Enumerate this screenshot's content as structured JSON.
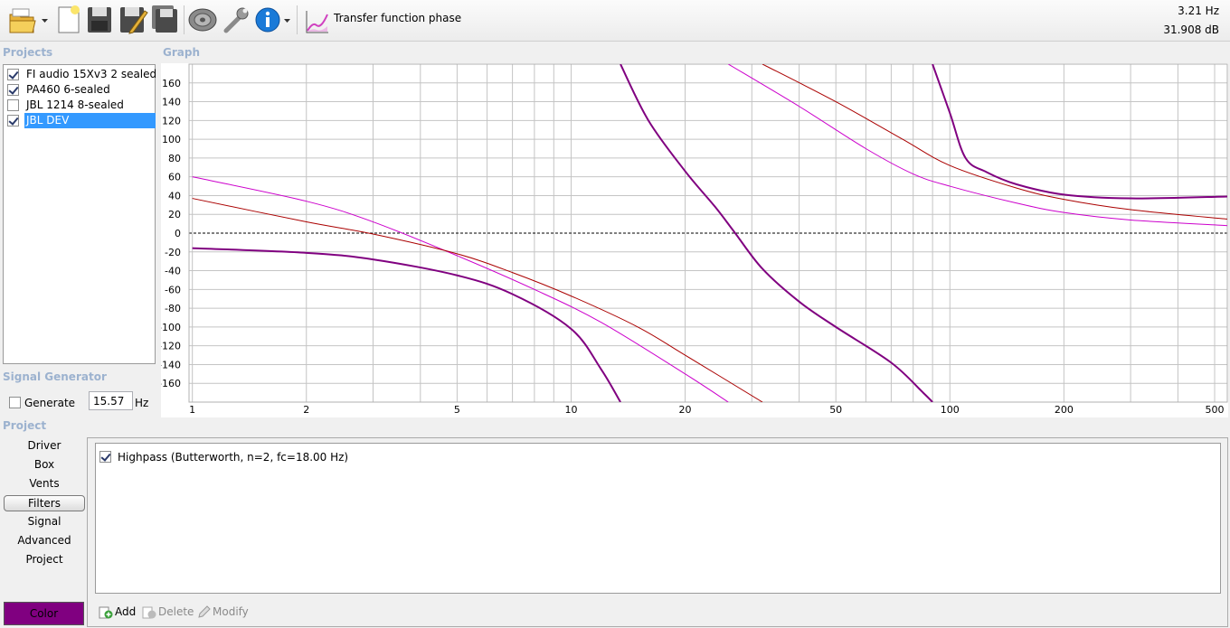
{
  "toolbar": {
    "function_label": "Transfer function phase",
    "readout_freq": "3.21 Hz",
    "readout_level": "31.908 dB"
  },
  "projects": {
    "header": "Projects",
    "items": [
      {
        "name": "FI audio 15Xv3 2 sealed",
        "checked": true,
        "selected": false
      },
      {
        "name": "PA460 6-sealed",
        "checked": true,
        "selected": false
      },
      {
        "name": "JBL 1214 8-sealed",
        "checked": false,
        "selected": false
      },
      {
        "name": "JBL DEV",
        "checked": true,
        "selected": true
      }
    ]
  },
  "graph": {
    "header": "Graph"
  },
  "signal_generator": {
    "header": "Signal Generator",
    "generate_label": "Generate",
    "generate_checked": false,
    "frequency_value": "15.57",
    "unit": "Hz"
  },
  "project": {
    "header": "Project",
    "nav": [
      "Driver",
      "Box",
      "Vents",
      "Filters",
      "Signal",
      "Advanced",
      "Project"
    ],
    "active_nav": "Filters",
    "color_label": "Color",
    "color_value": "#800080"
  },
  "filters": {
    "items": [
      {
        "label": "Highpass (Butterworth, n=2, fc=18.00 Hz)",
        "checked": true
      }
    ],
    "add_label": "Add",
    "delete_label": "Delete",
    "modify_label": "Modify"
  },
  "chart_data": {
    "type": "line",
    "xscale": "log",
    "xlim": [
      0.98,
      540
    ],
    "ylim": [
      -180,
      180
    ],
    "x_ticks": [
      1,
      2,
      5,
      10,
      20,
      50,
      100,
      200,
      500
    ],
    "y_ticks": [
      160,
      140,
      120,
      100,
      80,
      60,
      40,
      20,
      0,
      -20,
      -40,
      -60,
      -80,
      -100,
      -120,
      -140,
      -160
    ],
    "zero_line": "dashed",
    "grid": true,
    "series": [
      {
        "color": "#800080",
        "width": 2,
        "points": [
          [
            1,
            -16
          ],
          [
            2,
            -21
          ],
          [
            3,
            -28
          ],
          [
            5,
            -45
          ],
          [
            7,
            -65
          ],
          [
            10,
            -102
          ],
          [
            12,
            -145
          ],
          [
            13.5,
            -180
          ]
        ]
      },
      {
        "color": "#800080",
        "width": 2,
        "points": [
          [
            13.5,
            180
          ],
          [
            16,
            120
          ],
          [
            20,
            66
          ],
          [
            24,
            28
          ],
          [
            27,
            1
          ],
          [
            32,
            -38
          ],
          [
            40,
            -73
          ],
          [
            50,
            -100
          ],
          [
            70,
            -138
          ],
          [
            85,
            -170
          ],
          [
            90,
            -180
          ]
        ]
      },
      {
        "color": "#800080",
        "width": 2,
        "points": [
          [
            90,
            180
          ],
          [
            100,
            128
          ],
          [
            110,
            80
          ],
          [
            125,
            65
          ],
          [
            150,
            52
          ],
          [
            200,
            41
          ],
          [
            300,
            37
          ],
          [
            540,
            39
          ]
        ]
      },
      {
        "color": "#cc00cc",
        "width": 1,
        "points": [
          [
            1,
            60
          ],
          [
            2,
            34
          ],
          [
            3,
            12
          ],
          [
            5,
            -24
          ],
          [
            8,
            -60
          ],
          [
            12,
            -95
          ],
          [
            20,
            -150
          ],
          [
            26,
            -180
          ]
        ]
      },
      {
        "color": "#cc00cc",
        "width": 1,
        "points": [
          [
            26,
            180
          ],
          [
            40,
            135
          ],
          [
            60,
            90
          ],
          [
            80,
            63
          ],
          [
            100,
            50
          ],
          [
            150,
            32
          ],
          [
            200,
            22
          ],
          [
            300,
            14
          ],
          [
            540,
            8
          ]
        ]
      },
      {
        "color": "#aa0000",
        "width": 1,
        "points": [
          [
            1,
            37
          ],
          [
            2,
            12
          ],
          [
            3,
            -1
          ],
          [
            5,
            -22
          ],
          [
            7,
            -42
          ],
          [
            10,
            -67
          ],
          [
            15,
            -100
          ],
          [
            20,
            -130
          ],
          [
            32,
            -180
          ]
        ]
      },
      {
        "color": "#aa0000",
        "width": 1,
        "points": [
          [
            32,
            180
          ],
          [
            50,
            140
          ],
          [
            75,
            100
          ],
          [
            100,
            72
          ],
          [
            150,
            48
          ],
          [
            200,
            36
          ],
          [
            300,
            25
          ],
          [
            540,
            15
          ]
        ]
      }
    ]
  }
}
